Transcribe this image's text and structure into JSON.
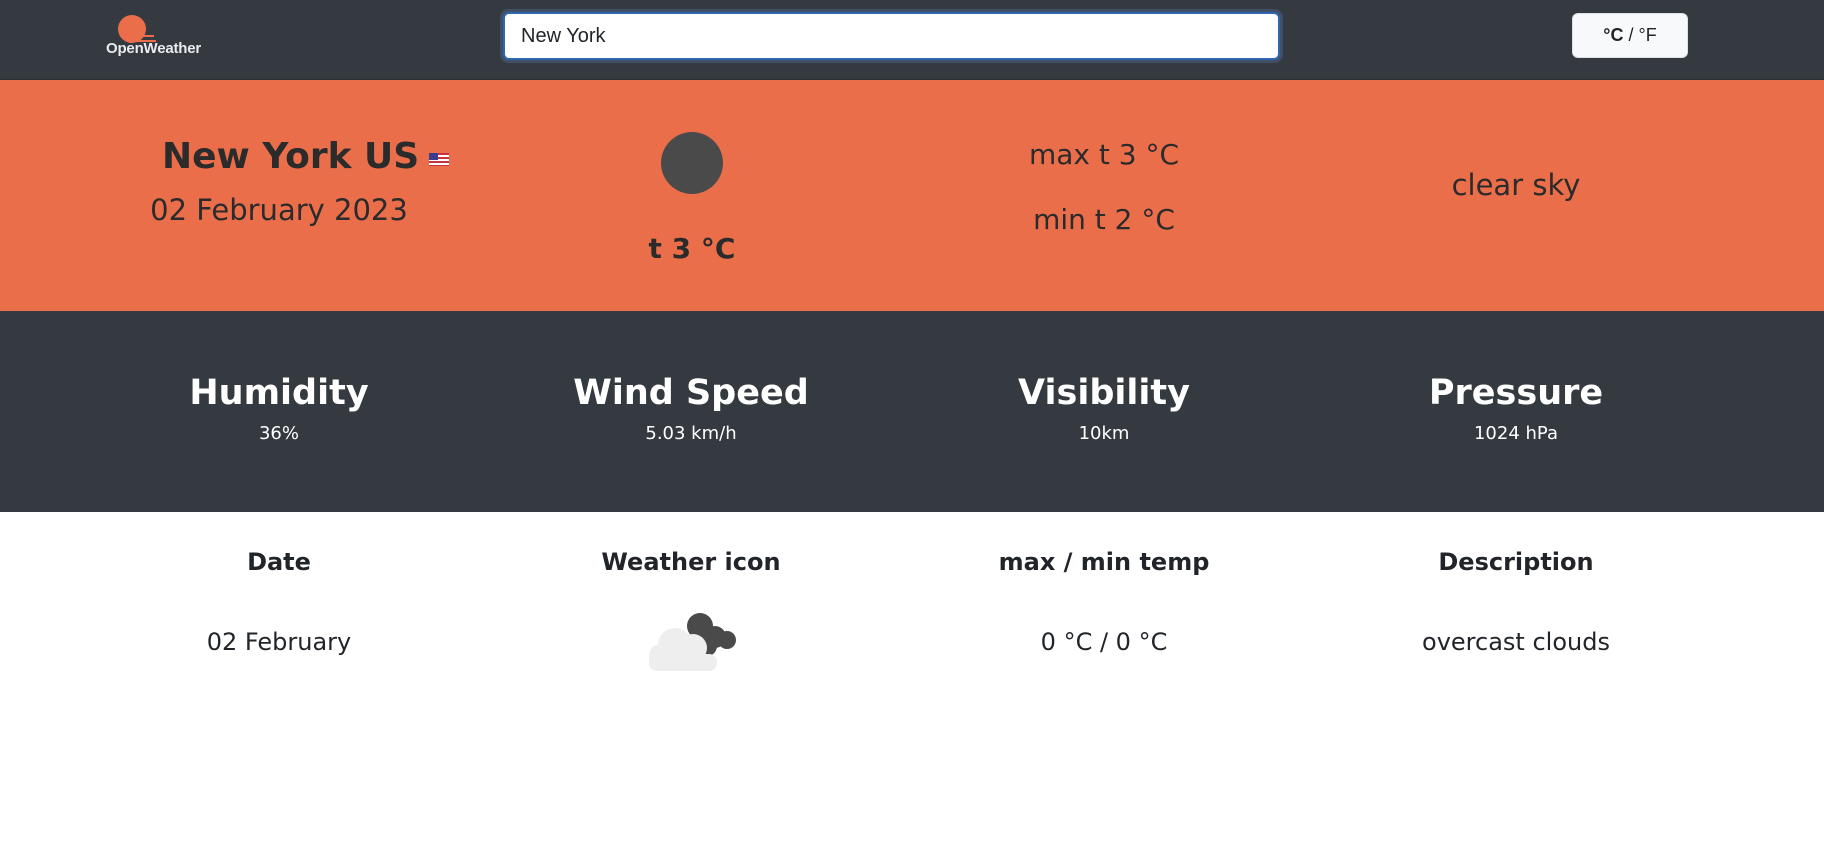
{
  "header": {
    "logo_text": "OpenWeather",
    "search": {
      "value": "New York",
      "placeholder": ""
    },
    "unit_toggle": {
      "celsius": "°C",
      "separator": " / ",
      "fahrenheit": "°F"
    }
  },
  "current": {
    "city": "New York US",
    "country_flag": "us-flag",
    "date": "02 February 2023",
    "weather_icon": "dark-circle-icon",
    "temp": "t 3 °C",
    "max_temp": "max t 3 °C",
    "min_temp": "min t 2 °C",
    "description": "clear sky"
  },
  "stats": [
    {
      "label": "Humidity",
      "value": "36%"
    },
    {
      "label": "Wind Speed",
      "value": "5.03 km/h"
    },
    {
      "label": "Visibility",
      "value": "10km"
    },
    {
      "label": "Pressure",
      "value": "1024 hPa"
    }
  ],
  "forecast": {
    "headers": [
      "Date",
      "Weather icon",
      "max / min temp",
      "Description"
    ],
    "rows": [
      {
        "date": "02 February",
        "icon": "overcast-clouds-icon",
        "temp": "0 °C / 0 °C",
        "description": "overcast clouds"
      }
    ]
  },
  "colors": {
    "navbar": "#343a40",
    "accent": "#eb6e4b",
    "search_border": "#2f66b0"
  }
}
